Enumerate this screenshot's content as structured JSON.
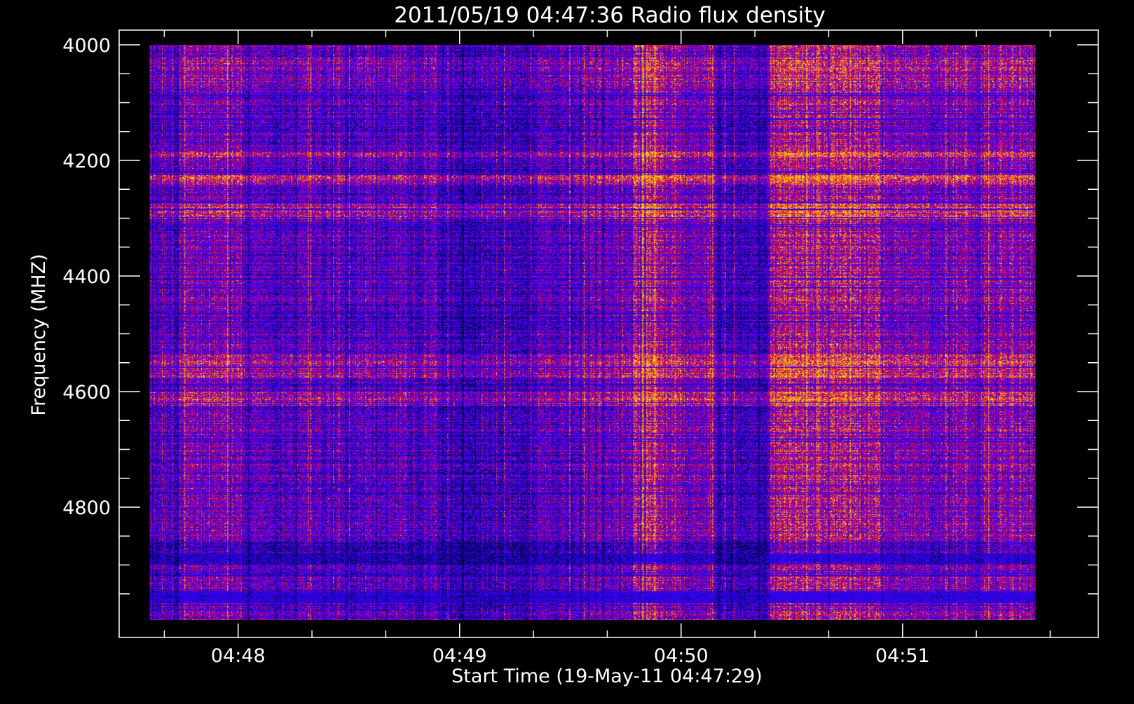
{
  "chart_data": {
    "type": "heatmap",
    "title": "2011/05/19 04:47:36 Radio flux density",
    "xlabel": "Start Time (19-May-11 04:47:29)",
    "ylabel": "Frequency (MHZ)",
    "x_ticks": [
      {
        "label": "04:48",
        "seconds": 31
      },
      {
        "label": "04:49",
        "seconds": 91
      },
      {
        "label": "04:50",
        "seconds": 151
      },
      {
        "label": "04:51",
        "seconds": 211
      }
    ],
    "y_ticks": [
      4000,
      4200,
      4400,
      4600,
      4800
    ],
    "ylim_mhz": [
      4000,
      5000
    ],
    "y_inverted": true,
    "data_time_range_seconds": [
      7,
      247
    ],
    "data_freq_range_mhz": [
      4000,
      4995
    ],
    "colormap": [
      "#000000",
      "#0000ff",
      "#ff0000",
      "#ffff00"
    ],
    "axis_color": "#ffffff",
    "background": "#000000"
  }
}
